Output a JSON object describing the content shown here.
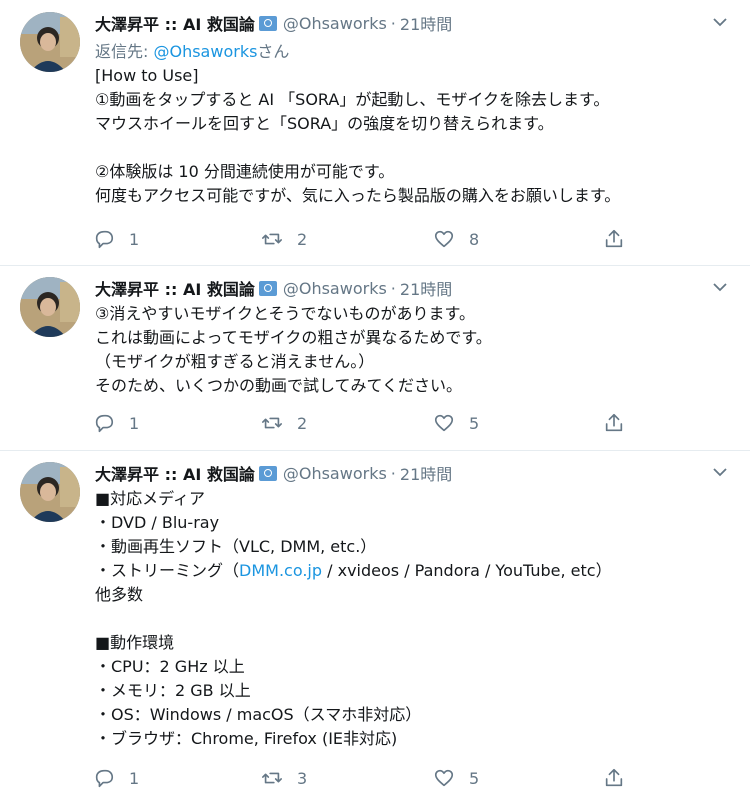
{
  "tweets": [
    {
      "name": "大澤昇平 :: AI 救国論",
      "handle": "@Ohsaworks",
      "time": "21時間",
      "reply_prefix": "返信先: ",
      "reply_mention": "@Ohsaworks",
      "reply_suffix": "さん",
      "lines": [
        "[How to Use]",
        "①動画をタップすると AI 「SORA」が起動し、モザイクを除去します。",
        "マウスホイールを回すと「SORA」の強度を切り替えられます。",
        "",
        "②体験版は 10 分間連続使用が可能です。",
        "何度もアクセス可能ですが、気に入ったら製品版の購入をお願いします。"
      ],
      "replies": "1",
      "retweets": "2",
      "likes": "8"
    },
    {
      "name": "大澤昇平 :: AI 救国論",
      "handle": "@Ohsaworks",
      "time": "21時間",
      "lines": [
        "③消えやすいモザイクとそうでないものがあります。",
        "これは動画によってモザイクの粗さが異なるためです。",
        "（モザイクが粗すぎると消えません。）",
        "そのため、いくつかの動画で試してみてください。"
      ],
      "replies": "1",
      "retweets": "2",
      "likes": "5"
    },
    {
      "name": "大澤昇平 :: AI 救国論",
      "handle": "@Ohsaworks",
      "time": "21時間",
      "lines": [
        "■対応メディア",
        "・DVD / Blu-ray",
        "・動画再生ソフト（VLC, DMM, etc.）",
        "・ストリーミング（",
        "DMM.co.jp",
        " / xvideos / Pandora / YouTube, etc）",
        "他多数",
        "",
        "■動作環境",
        "・CPU：2 GHz 以上",
        "・メモリ：2 GB 以上",
        "・OS：Windows / macOS（スマホ非対応）",
        "・ブラウザ：Chrome, Firefox (IE非対応)"
      ],
      "replies": "1",
      "retweets": "3",
      "likes": "5"
    }
  ],
  "icons": {
    "avatar": "avatar-photo",
    "verified": "verified-badge-icon",
    "caret": "chevron-down-icon",
    "reply": "reply-icon",
    "retweet": "retweet-icon",
    "like": "heart-icon",
    "share": "share-icon"
  },
  "colors": {
    "link": "#1b95e0",
    "muted": "#657786",
    "text": "#14171a",
    "divider": "#e6ecf0"
  }
}
